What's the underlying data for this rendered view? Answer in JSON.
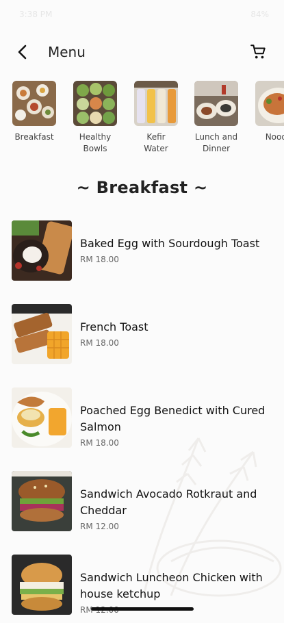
{
  "status_bar": {
    "time": "3:38 PM",
    "battery": "84%"
  },
  "header": {
    "title": "Menu"
  },
  "categories": [
    {
      "label": "Breakfast"
    },
    {
      "label": "Healthy\nBowls"
    },
    {
      "label": "Kefir\nWater"
    },
    {
      "label": "Lunch and\nDinner"
    },
    {
      "label": "Noodl"
    }
  ],
  "section": {
    "title": "~ Breakfast ~"
  },
  "items": [
    {
      "name": "Baked Egg with Sourdough Toast",
      "price": "RM 18.00"
    },
    {
      "name": "French Toast",
      "price": "RM 18.00"
    },
    {
      "name": "Poached Egg Benedict with Cured Salmon",
      "price": "RM 18.00"
    },
    {
      "name": "Sandwich Avocado Rotkraut and Cheddar",
      "price": "RM 12.00"
    },
    {
      "name": "Sandwich Luncheon Chicken with house ketchup",
      "price": "RM 12.00"
    }
  ]
}
